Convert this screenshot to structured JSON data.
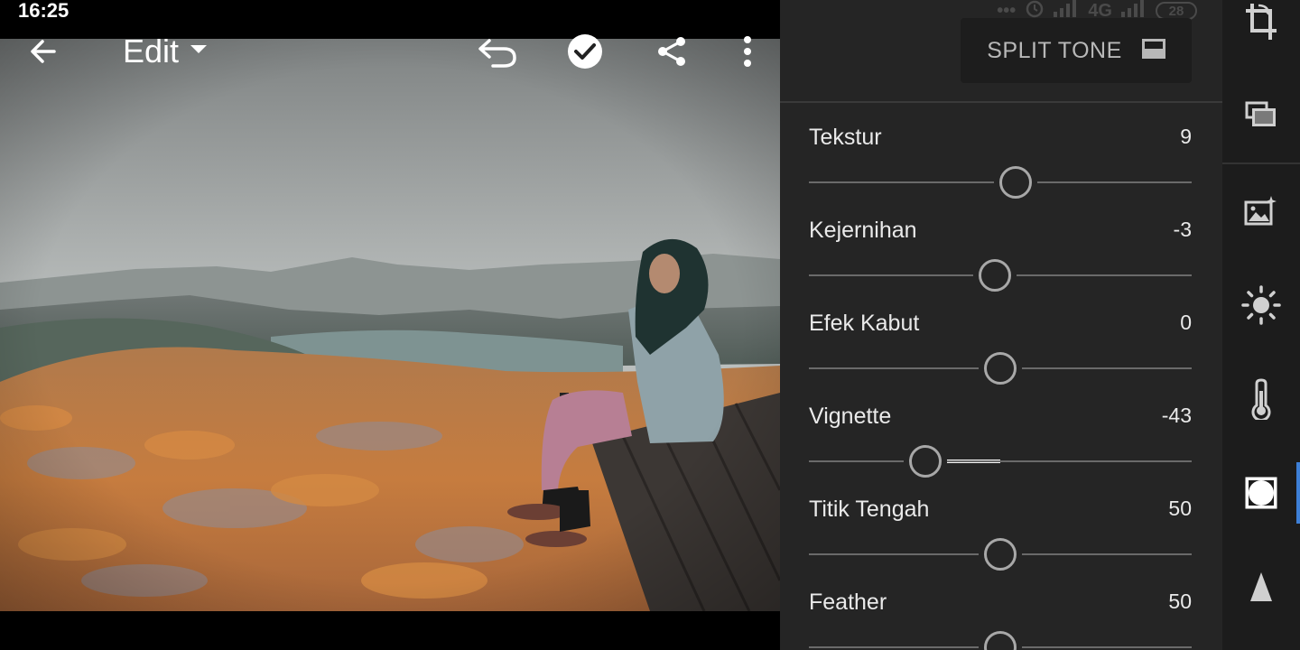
{
  "status_bar": {
    "time": "16:25",
    "network": "4G",
    "battery": "28"
  },
  "toolbar": {
    "mode_label": "Edit",
    "icons": [
      "back-arrow-icon",
      "dropdown-caret-icon",
      "undo-icon",
      "check-icon",
      "share-icon",
      "more-vertical-icon"
    ]
  },
  "panel": {
    "preset_button_label": "SPLIT TONE",
    "sliders": [
      {
        "label": "Tekstur",
        "value": "9",
        "min": -100,
        "max": 100,
        "num": 9
      },
      {
        "label": "Kejernihan",
        "value": "-3",
        "min": -100,
        "max": 100,
        "num": -3
      },
      {
        "label": "Efek Kabut",
        "value": "0",
        "min": -100,
        "max": 100,
        "num": 0
      },
      {
        "label": "Vignette",
        "value": "-43",
        "min": -100,
        "max": 100,
        "num": -43
      },
      {
        "label": "Titik Tengah",
        "value": "50",
        "min": 0,
        "max": 100,
        "num": 50
      },
      {
        "label": "Feather",
        "value": "50",
        "min": 0,
        "max": 100,
        "num": 50
      }
    ]
  },
  "tool_rail": {
    "tools": [
      "crop-icon",
      "presets-icon",
      "auto-enhance-icon",
      "light-icon",
      "color-temperature-icon",
      "effects-icon",
      "detail-icon"
    ],
    "active_tool": "effects-icon",
    "accent_color": "#3d7fd6"
  }
}
